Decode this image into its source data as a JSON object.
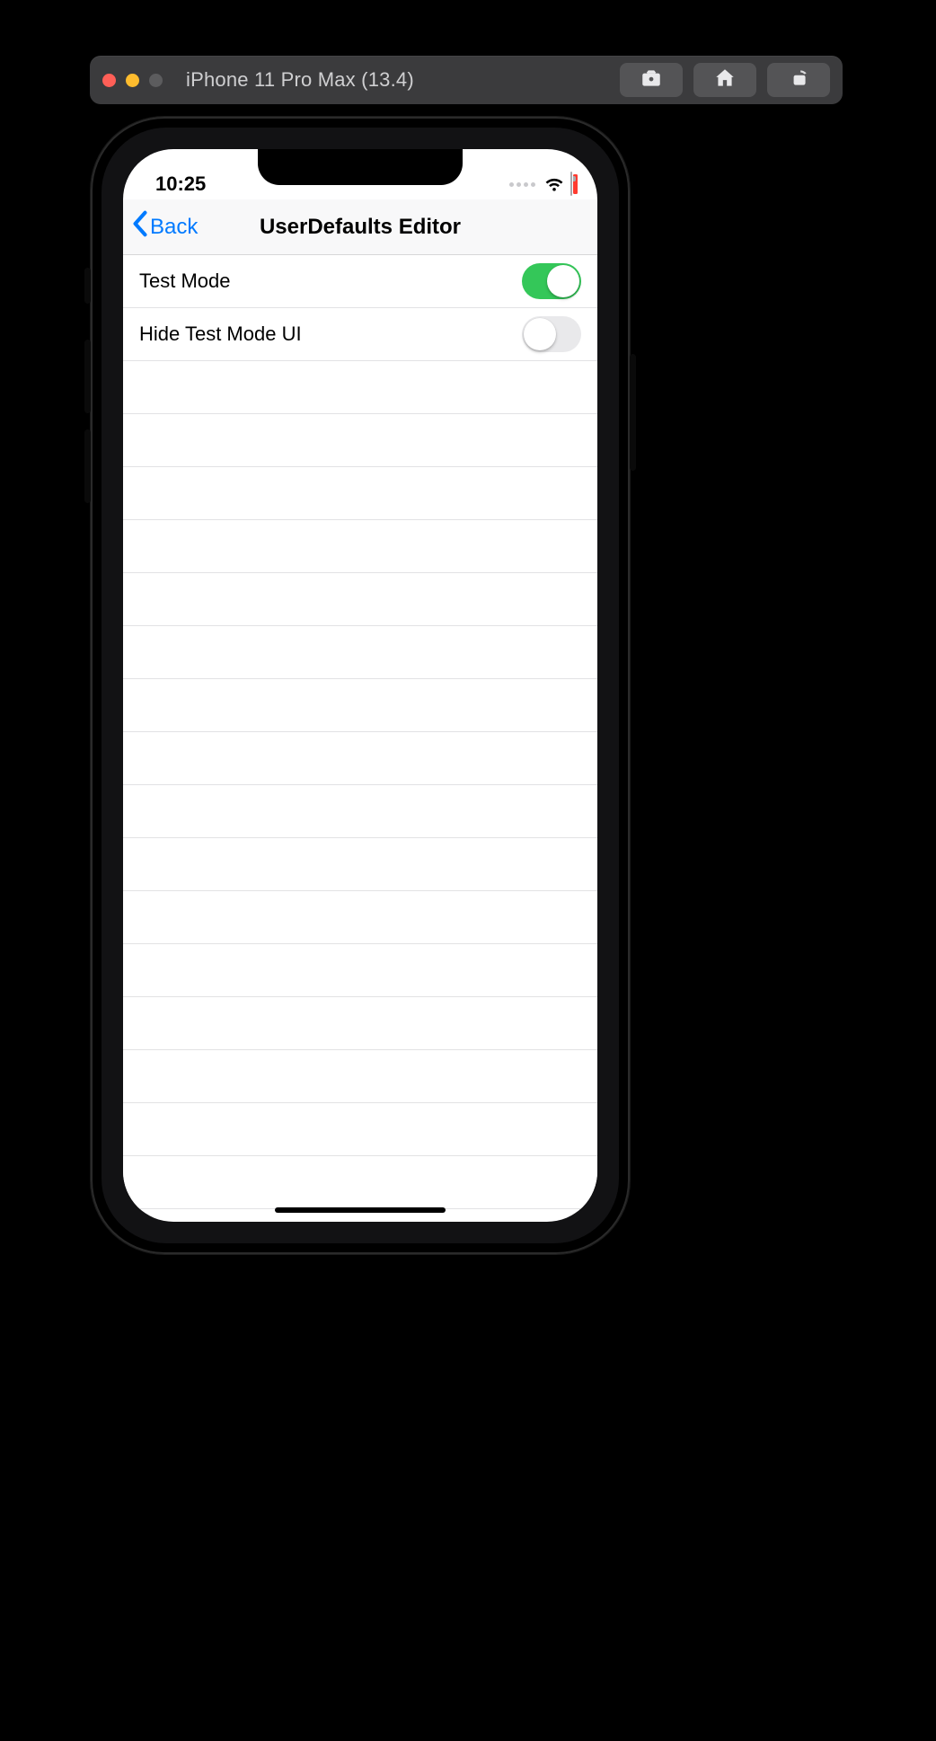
{
  "simulator": {
    "title": "iPhone 11 Pro Max (13.4)"
  },
  "status_bar": {
    "time": "10:25"
  },
  "nav": {
    "back_label": "Back",
    "title": "UserDefaults Editor"
  },
  "settings": [
    {
      "label": "Test Mode",
      "value": true
    },
    {
      "label": "Hide Test Mode UI",
      "value": false
    }
  ],
  "empty_row_count": 16,
  "colors": {
    "ios_blue": "#007aff",
    "ios_green": "#34c759",
    "ios_red": "#ff3b30"
  }
}
